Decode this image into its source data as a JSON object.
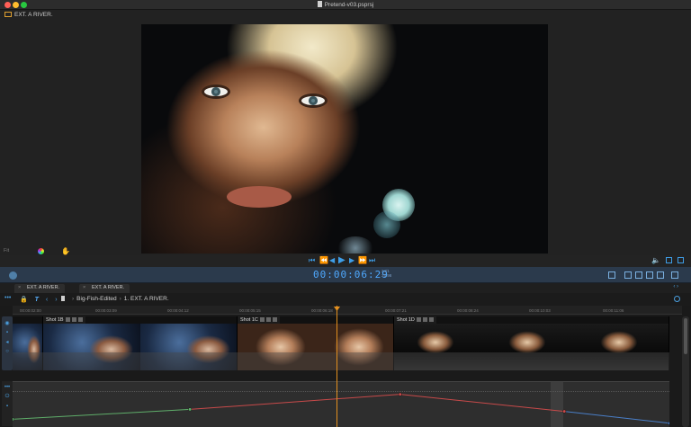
{
  "window": {
    "title": "Pretend-v03.psprsj"
  },
  "viewer": {
    "label": "EXT. A RIVER.",
    "status_left": "Fit"
  },
  "transport": {
    "buttons": [
      {
        "name": "go-to-start",
        "glyph": "⏮"
      },
      {
        "name": "step-back",
        "glyph": "⏪"
      },
      {
        "name": "frame-back",
        "glyph": "◀"
      },
      {
        "name": "play",
        "glyph": "▶"
      },
      {
        "name": "frame-forward",
        "glyph": "▶"
      },
      {
        "name": "step-forward",
        "glyph": "⏩"
      },
      {
        "name": "go-to-end",
        "glyph": "⏭"
      }
    ]
  },
  "timebar": {
    "timecode": "00:00:06:29",
    "fps_line1": "24/1",
    "fps_line2": "23.98"
  },
  "tabs": [
    {
      "label": "EXT. A RIVER."
    },
    {
      "label": "EXT. A RIVER."
    }
  ],
  "breadcrumb": {
    "items": [
      "Big-Fish-Edited",
      "1. EXT. A RIVER."
    ]
  },
  "ruler": {
    "ticks": [
      "00:00:02:00",
      "00:00:03:09",
      "00:00:04:12",
      "00:00:05:15",
      "00:00:06:18",
      "00:00:07:21",
      "00:00:08:24",
      "00:00:10:03",
      "00:00:11:06"
    ]
  },
  "clips": [
    {
      "label": "Shot 1B"
    },
    {
      "label": "Shot 1C"
    },
    {
      "label": "Shot 1D"
    }
  ],
  "audio_curve": {
    "points": [
      {
        "x": 0.0,
        "y": 0.15,
        "color": "#5fae6a"
      },
      {
        "x": 0.27,
        "y": 0.4,
        "color": "#5fae6a"
      },
      {
        "x": 0.59,
        "y": 0.78,
        "color": "#c84a4a"
      },
      {
        "x": 0.84,
        "y": 0.35,
        "color": "#c84a4a"
      },
      {
        "x": 1.0,
        "y": 0.05,
        "color": "#4a7fc8"
      }
    ]
  },
  "colors": {
    "accent": "#3e9ee8",
    "timecode": "#4fa9ff",
    "playhead": "#e3901f"
  }
}
